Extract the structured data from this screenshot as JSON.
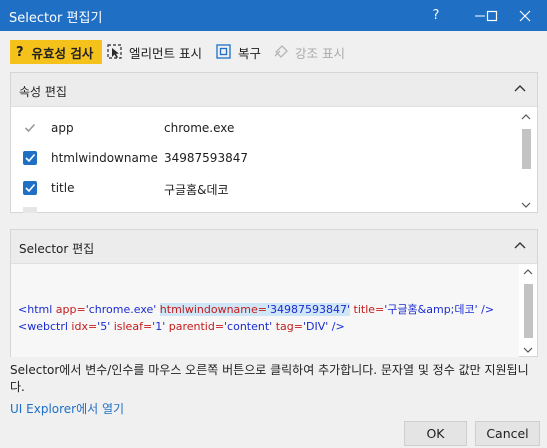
{
  "window": {
    "title": "Selector 편집기",
    "help": "?",
    "controls": [
      "minimize",
      "maximize",
      "close"
    ]
  },
  "toolbar": {
    "validate_label": "유효성 검사",
    "indicate_label": "엘리먼트 표시",
    "repair_label": "복구",
    "highlight_label": "강조 표시",
    "highlight_enabled": false,
    "validate_color": "#f5c11b"
  },
  "attributes_panel": {
    "title": "속성 편집",
    "rows": [
      {
        "name": "app",
        "value": "chrome.exe",
        "checked": true,
        "enabled": false
      },
      {
        "name": "htmlwindowname",
        "value": "34987593847",
        "checked": true,
        "enabled": true
      },
      {
        "name": "title",
        "value": "구글홈&데코",
        "checked": true,
        "enabled": true
      }
    ]
  },
  "selector_panel": {
    "title": "Selector 편집",
    "line1": {
      "open": "<html ",
      "app_attr": "app=",
      "app_val": "'chrome.exe'",
      "win_attr": "htmlwindowname=",
      "win_val": "'34987593847'",
      "title_attr": "title=",
      "title_val": "'구글홈&amp;데코'",
      "close": " />"
    },
    "line2": {
      "open": "<webctrl ",
      "idx_attr": "idx=",
      "idx_val": "'5'",
      "isleaf_attr": "isleaf=",
      "isleaf_val": "'1'",
      "parentid_attr": "parentid=",
      "parentid_val": "'content'",
      "tag_attr": "tag=",
      "tag_val": "'DIV'",
      "close": " />"
    }
  },
  "hint": "Selector에서 변수/인수를 마우스 오른쪽 버튼으로 클릭하여 추가합니다. 문자열 및 정수 값만 지원됩니다.",
  "link": "UI Explorer에서 열기",
  "buttons": {
    "ok": "OK",
    "cancel": "Cancel"
  },
  "colors": {
    "titlebar": "#1f6fc5",
    "accent": "#1f6fc5"
  }
}
